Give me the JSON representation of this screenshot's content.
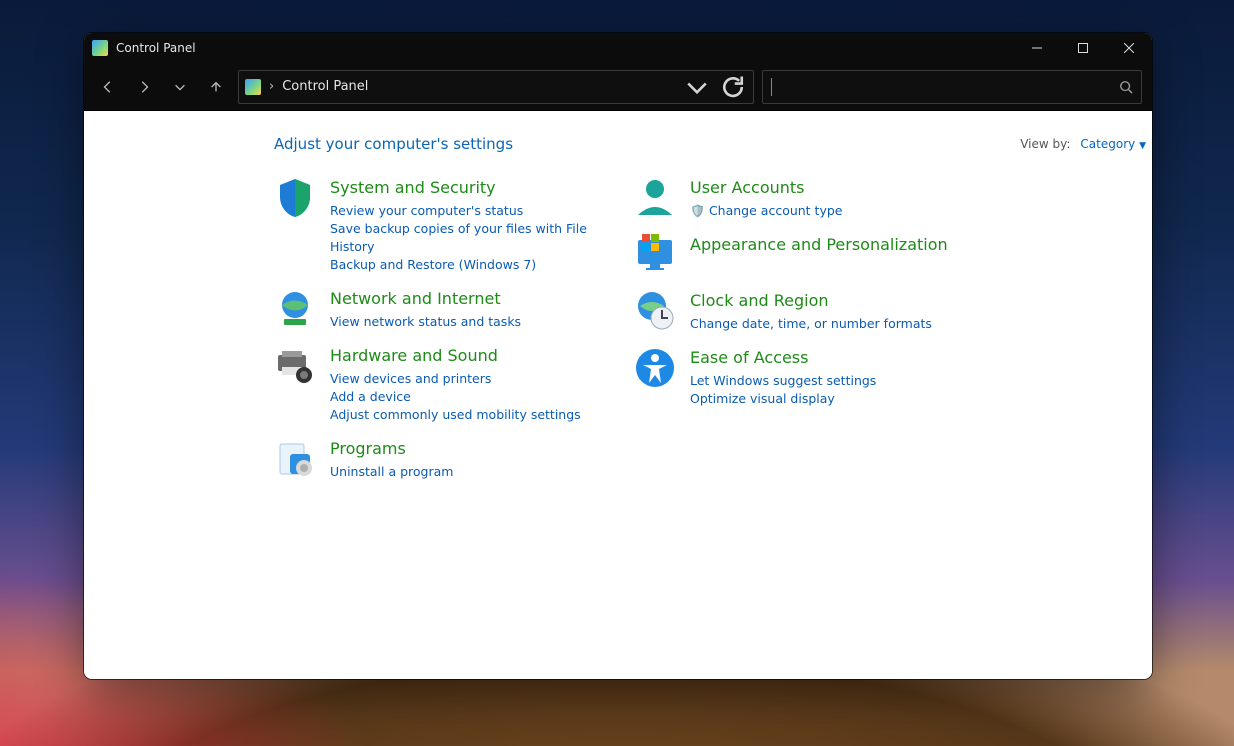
{
  "window": {
    "title": "Control Panel"
  },
  "address": {
    "crumb": "Control Panel"
  },
  "search": {
    "placeholder": ""
  },
  "main": {
    "heading": "Adjust your computer's settings",
    "viewby_label": "View by:",
    "viewby_value": "Category"
  },
  "left": [
    {
      "title": "System and Security",
      "links": [
        "Review your computer's status",
        "Save backup copies of your files with File History",
        "Backup and Restore (Windows 7)"
      ]
    },
    {
      "title": "Network and Internet",
      "links": [
        "View network status and tasks"
      ]
    },
    {
      "title": "Hardware and Sound",
      "links": [
        "View devices and printers",
        "Add a device",
        "Adjust commonly used mobility settings"
      ]
    },
    {
      "title": "Programs",
      "links": [
        "Uninstall a program"
      ]
    }
  ],
  "right": [
    {
      "title": "User Accounts",
      "links": [
        "Change account type"
      ],
      "shield_on_links": [
        0
      ]
    },
    {
      "title": "Appearance and Personalization",
      "links": []
    },
    {
      "title": "Clock and Region",
      "links": [
        "Change date, time, or number formats"
      ]
    },
    {
      "title": "Ease of Access",
      "links": [
        "Let Windows suggest settings",
        "Optimize visual display"
      ]
    }
  ]
}
